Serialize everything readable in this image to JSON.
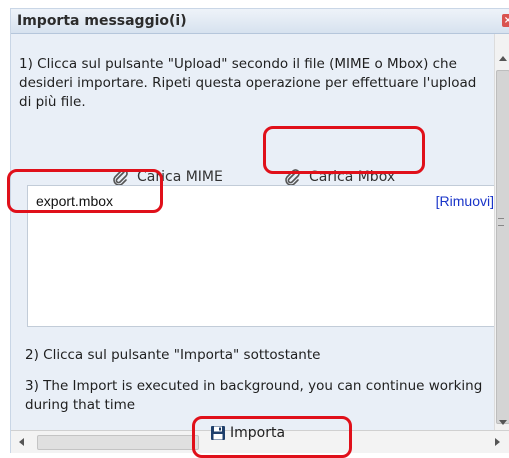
{
  "dialog": {
    "title": "Importa messaggio(i)",
    "close_icon": "close-icon",
    "step1_text": "1) Clicca sul pulsante \"Upload\" secondo il file (MIME o Mbox) che desideri importare. Ripeti questa operazione per effettuare l'upload di più file.",
    "upload_buttons": [
      {
        "label": "Carica MIME",
        "icon": "paperclip-icon"
      },
      {
        "label": "Carica Mbox",
        "icon": "paperclip-icon"
      }
    ],
    "file_list": [
      {
        "name": "export.mbox",
        "remove_label": "[Rimuovi]"
      }
    ],
    "step2_text": "2) Clicca sul pulsante \"Importa\" sottostante",
    "step3_text": "3) The Import is executed in background, you can continue working during that time",
    "import_button": {
      "label": "Importa",
      "icon": "floppy-disk-icon"
    }
  },
  "colors": {
    "annotation": "#e0101a",
    "link": "#1a35c9",
    "panel_bg": "#e9eff7"
  }
}
